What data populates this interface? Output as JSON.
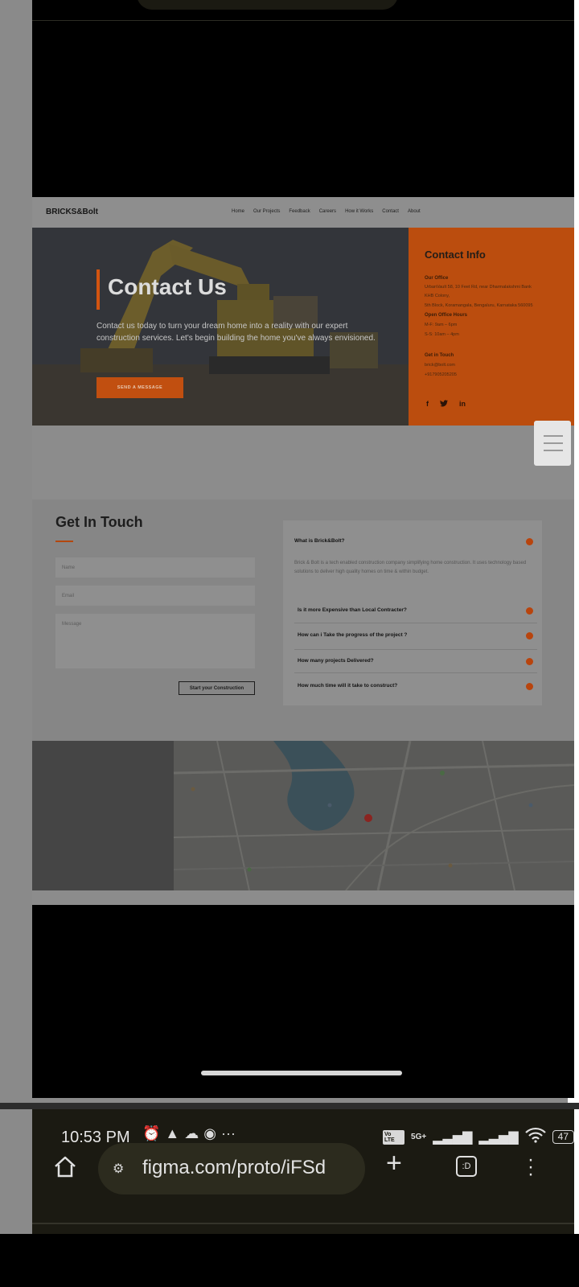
{
  "site": {
    "brand": "BRICKS&Bolt",
    "nav": [
      "Home",
      "Our Projects",
      "Feedback",
      "Careers",
      "How it Works",
      "Contact",
      "About"
    ],
    "hero": {
      "title": "Contact Us",
      "subtitle": "Contact us today to turn your dream home into a reality with our expert construction services. Let's begin building the home you've always envisioned.",
      "button": "SEND A MESSAGE"
    },
    "contact_info": {
      "title": "Contact Info",
      "office_heading": "Our Office",
      "office_lines": [
        "UrbanVault 58, 10 Feet Rd, near Dharmalakshmi Bank",
        "KHB Colony,",
        "5th Block, Koramangala, Bengaluru, Karnataka 560095"
      ],
      "hours_heading": "Open Office Hours",
      "hours_lines": [
        "M-F: 9am – 6pm",
        "S-S: 10am – 4pm"
      ],
      "touch_heading": "Get in Touch",
      "touch_lines": [
        "brick@bolt.com",
        "+917905205205"
      ],
      "socials": [
        "f",
        "t",
        "in"
      ]
    },
    "get_in_touch": {
      "title": "Get In Touch",
      "fields": {
        "name": "Name",
        "email": "Email",
        "message": "Message"
      },
      "submit": "Start your Construction"
    },
    "faq": {
      "items": [
        {
          "q": "What is Brick&Bolt?",
          "a": "Brick & Bolt is a tech enabled construction company simplifying home construction. It uses technology based solutions to deliver high quality homes on time & within budget."
        },
        {
          "q": "Is it more Expensive than Local Contracter?"
        },
        {
          "q": "How can i Take the progress of the project ?"
        },
        {
          "q": "How many projects Delivered?"
        },
        {
          "q": "How much time will it take to construct?"
        }
      ]
    }
  },
  "statusbar": {
    "time": "10:53 PM",
    "network": "5G+",
    "volte": "Vo LTE",
    "battery": "47"
  },
  "browser": {
    "url": "figma.com/proto/iFSd",
    "tabs_label": ":D"
  },
  "colors": {
    "accent": "#c14f10",
    "dim_overlay": "#8a8a8a",
    "browser_bar": "#1b1a12"
  }
}
